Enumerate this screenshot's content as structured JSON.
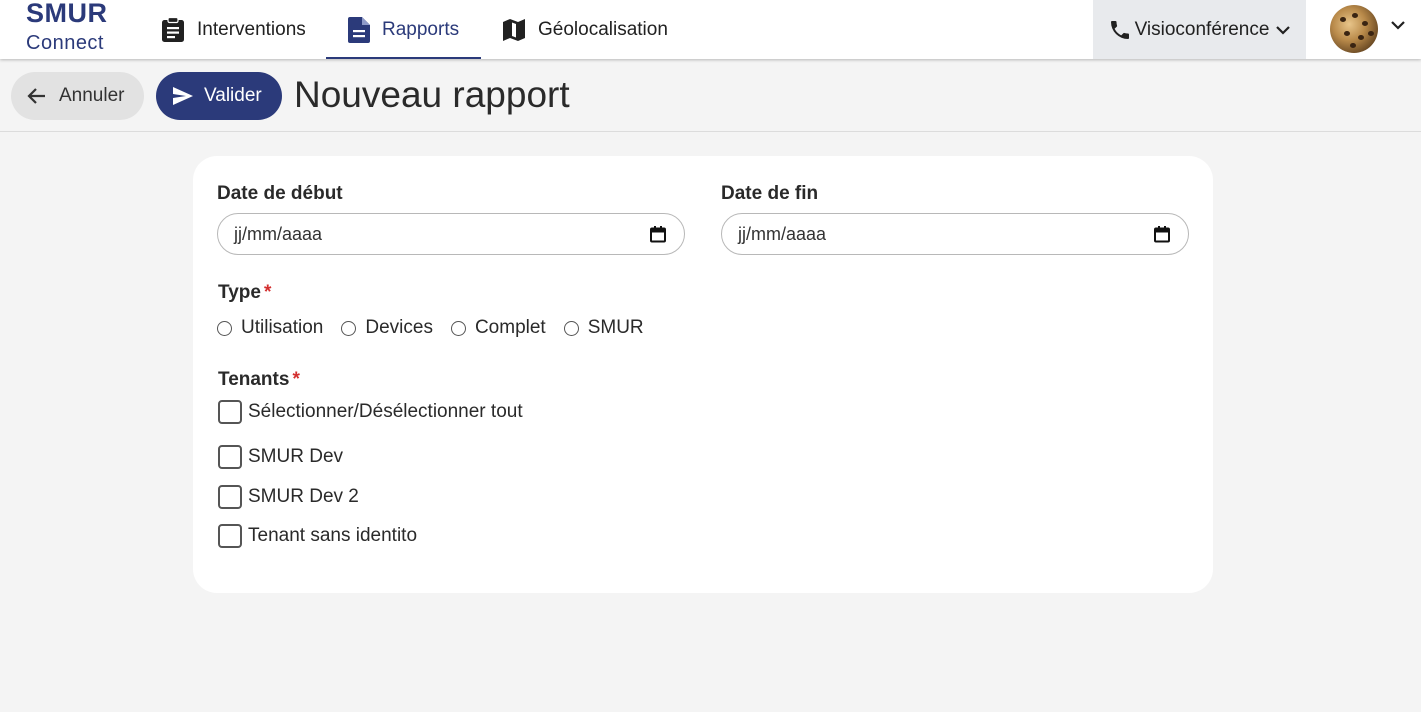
{
  "app": {
    "logo_top": "SMUR",
    "logo_bottom": "Connect"
  },
  "nav": {
    "tabs": [
      {
        "label": "Interventions",
        "icon": "clipboard-icon",
        "active": false
      },
      {
        "label": "Rapports",
        "icon": "document-icon",
        "active": true
      },
      {
        "label": "Géolocalisation",
        "icon": "map-icon",
        "active": false
      }
    ],
    "visio_label": "Visioconférence"
  },
  "header": {
    "cancel_label": "Annuler",
    "submit_label": "Valider",
    "title": "Nouveau rapport"
  },
  "form": {
    "start_date": {
      "label": "Date de début",
      "placeholder": "jj/mm/aaaa"
    },
    "end_date": {
      "label": "Date de fin",
      "placeholder": "jj/mm/aaaa"
    },
    "type": {
      "label": "Type",
      "required_mark": "*",
      "options": [
        "Utilisation",
        "Devices",
        "Complet",
        "SMUR"
      ]
    },
    "tenants": {
      "label": "Tenants",
      "required_mark": "*",
      "select_all_label": "Sélectionner/Désélectionner tout",
      "items": [
        "SMUR Dev",
        "SMUR Dev 2",
        "Tenant sans identito"
      ]
    }
  },
  "colors": {
    "brand": "#2b3a7a",
    "required": "#d32f2f",
    "page_bg": "#f4f4f4"
  }
}
